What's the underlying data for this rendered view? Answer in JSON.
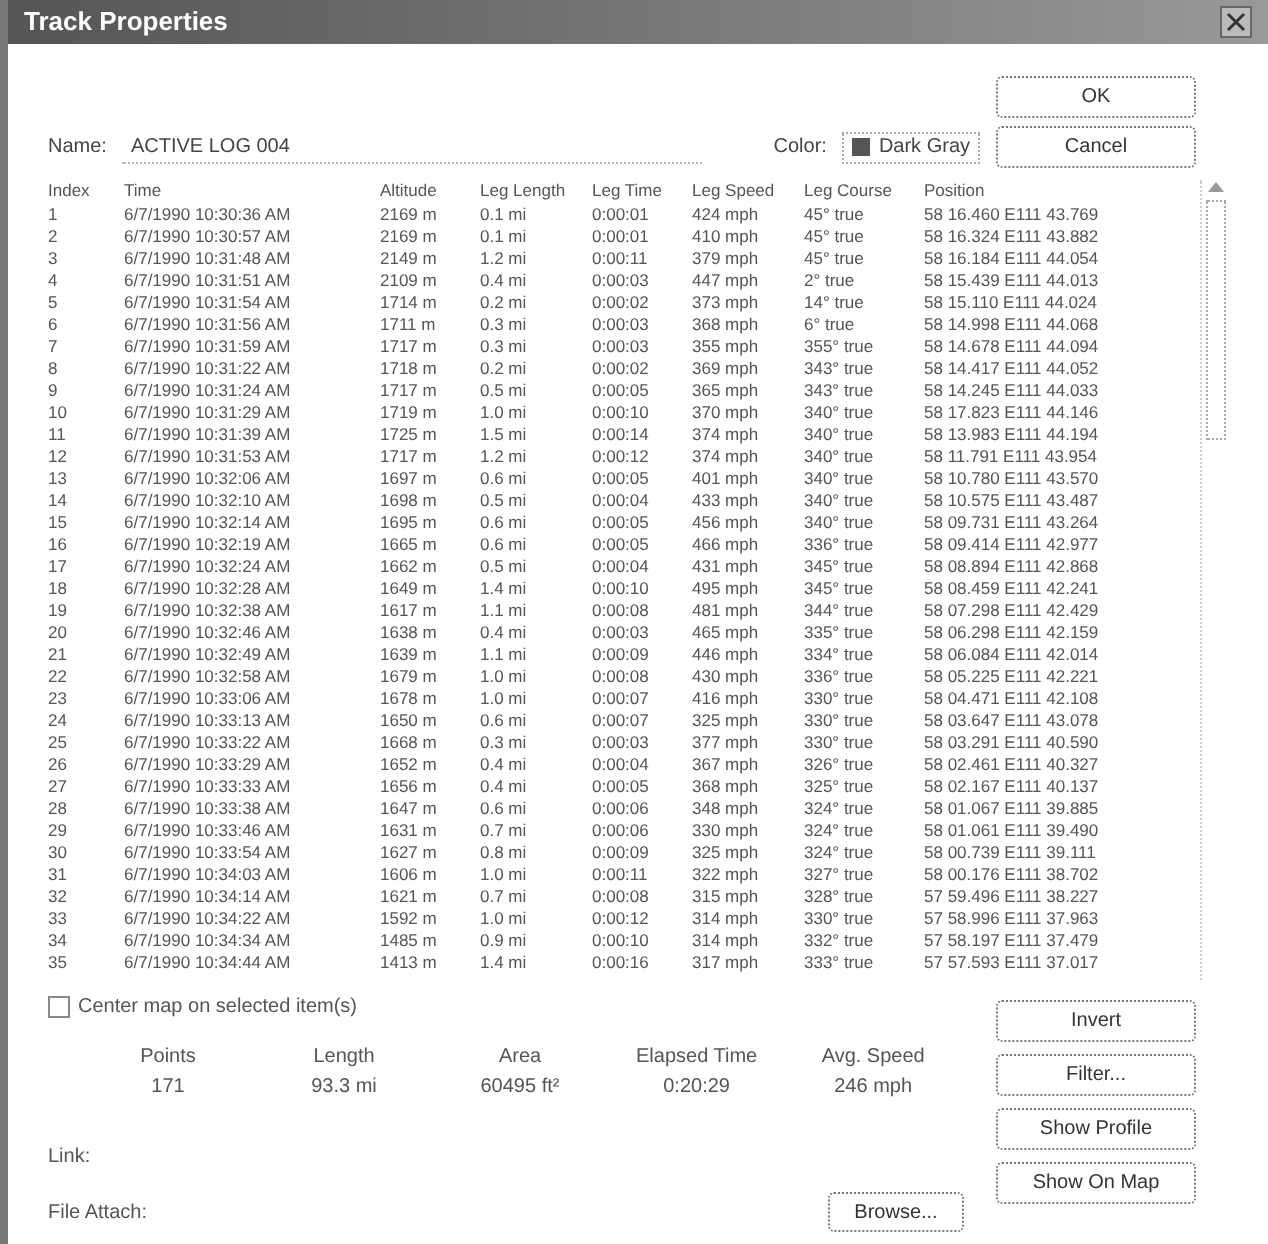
{
  "window": {
    "title": "Track Properties"
  },
  "name_field": {
    "label": "Name:",
    "value": "ACTIVE LOG 004"
  },
  "color_field": {
    "label": "Color:",
    "value": "Dark Gray",
    "color": "#555555"
  },
  "buttons_top": [
    "OK",
    "Cancel"
  ],
  "table": {
    "columns": [
      "Index",
      "Time",
      "Altitude",
      "Leg Length",
      "Leg Time",
      "Leg Speed",
      "Leg Course",
      "Position"
    ],
    "rows": [
      [
        "1",
        "6/7/1990 10:30:36 AM",
        "2169 m",
        "0.1 mi",
        "0:00:01",
        "424 mph",
        "45° true",
        "58 16.460 E111 43.769"
      ],
      [
        "2",
        "6/7/1990 10:30:57 AM",
        "2169 m",
        "0.1 mi",
        "0:00:01",
        "410 mph",
        "45° true",
        "58 16.324 E111 43.882"
      ],
      [
        "3",
        "6/7/1990 10:31:48 AM",
        "2149 m",
        "1.2 mi",
        "0:00:11",
        "379 mph",
        "45° true",
        "58 16.184 E111 44.054"
      ],
      [
        "4",
        "6/7/1990 10:31:51 AM",
        "2109 m",
        "0.4 mi",
        "0:00:03",
        "447 mph",
        "2° true",
        "58 15.439 E111 44.013"
      ],
      [
        "5",
        "6/7/1990 10:31:54 AM",
        "1714 m",
        "0.2 mi",
        "0:00:02",
        "373 mph",
        "14° true",
        "58 15.110 E111 44.024"
      ],
      [
        "6",
        "6/7/1990 10:31:56 AM",
        "1711 m",
        "0.3 mi",
        "0:00:03",
        "368 mph",
        "6° true",
        "58 14.998 E111 44.068"
      ],
      [
        "7",
        "6/7/1990 10:31:59 AM",
        "1717 m",
        "0.3 mi",
        "0:00:03",
        "355 mph",
        "355° true",
        "58 14.678 E111 44.094"
      ],
      [
        "8",
        "6/7/1990 10:31:22 AM",
        "1718 m",
        "0.2 mi",
        "0:00:02",
        "369 mph",
        "343° true",
        "58 14.417 E111 44.052"
      ],
      [
        "9",
        "6/7/1990 10:31:24 AM",
        "1717 m",
        "0.5 mi",
        "0:00:05",
        "365 mph",
        "343° true",
        "58 14.245 E111 44.033"
      ],
      [
        "10",
        "6/7/1990 10:31:29 AM",
        "1719 m",
        "1.0 mi",
        "0:00:10",
        "370 mph",
        "340° true",
        "58 17.823 E111 44.146"
      ],
      [
        "11",
        "6/7/1990 10:31:39 AM",
        "1725 m",
        "1.5 mi",
        "0:00:14",
        "374 mph",
        "340° true",
        "58 13.983 E111 44.194"
      ],
      [
        "12",
        "6/7/1990 10:31:53 AM",
        "1717 m",
        "1.2 mi",
        "0:00:12",
        "374 mph",
        "340° true",
        "58 11.791 E111 43.954"
      ],
      [
        "13",
        "6/7/1990 10:32:06 AM",
        "1697 m",
        "0.6 mi",
        "0:00:05",
        "401 mph",
        "340° true",
        "58 10.780 E111 43.570"
      ],
      [
        "14",
        "6/7/1990 10:32:10 AM",
        "1698 m",
        "0.5 mi",
        "0:00:04",
        "433 mph",
        "340° true",
        "58 10.575 E111 43.487"
      ],
      [
        "15",
        "6/7/1990 10:32:14 AM",
        "1695 m",
        "0.6 mi",
        "0:00:05",
        "456 mph",
        "340° true",
        "58 09.731 E111 43.264"
      ],
      [
        "16",
        "6/7/1990 10:32:19 AM",
        "1665 m",
        "0.6 mi",
        "0:00:05",
        "466 mph",
        "336° true",
        "58 09.414 E111 42.977"
      ],
      [
        "17",
        "6/7/1990 10:32:24 AM",
        "1662 m",
        "0.5 mi",
        "0:00:04",
        "431 mph",
        "345° true",
        "58 08.894 E111 42.868"
      ],
      [
        "18",
        "6/7/1990 10:32:28 AM",
        "1649 m",
        "1.4 mi",
        "0:00:10",
        "495 mph",
        "345° true",
        "58 08.459 E111 42.241"
      ],
      [
        "19",
        "6/7/1990 10:32:38 AM",
        "1617 m",
        "1.1 mi",
        "0:00:08",
        "481 mph",
        "344° true",
        "58 07.298 E111 42.429"
      ],
      [
        "20",
        "6/7/1990 10:32:46 AM",
        "1638 m",
        "0.4 mi",
        "0:00:03",
        "465 mph",
        "335° true",
        "58 06.298 E111 42.159"
      ],
      [
        "21",
        "6/7/1990 10:32:49 AM",
        "1639 m",
        "1.1 mi",
        "0:00:09",
        "446 mph",
        "334° true",
        "58 06.084 E111 42.014"
      ],
      [
        "22",
        "6/7/1990 10:32:58 AM",
        "1679 m",
        "1.0 mi",
        "0:00:08",
        "430 mph",
        "336° true",
        "58 05.225 E111 42.221"
      ],
      [
        "23",
        "6/7/1990 10:33:06 AM",
        "1678 m",
        "1.0 mi",
        "0:00:07",
        "416 mph",
        "330° true",
        "58 04.471 E111 42.108"
      ],
      [
        "24",
        "6/7/1990 10:33:13 AM",
        "1650 m",
        "0.6 mi",
        "0:00:07",
        "325 mph",
        "330° true",
        "58 03.647 E111 43.078"
      ],
      [
        "25",
        "6/7/1990 10:33:22 AM",
        "1668 m",
        "0.3 mi",
        "0:00:03",
        "377 mph",
        "330° true",
        "58 03.291 E111 40.590"
      ],
      [
        "26",
        "6/7/1990 10:33:29 AM",
        "1652 m",
        "0.4 mi",
        "0:00:04",
        "367 mph",
        "326° true",
        "58 02.461 E111 40.327"
      ],
      [
        "27",
        "6/7/1990 10:33:33 AM",
        "1656 m",
        "0.4 mi",
        "0:00:05",
        "368 mph",
        "325° true",
        "58 02.167 E111 40.137"
      ],
      [
        "28",
        "6/7/1990 10:33:38 AM",
        "1647 m",
        "0.6 mi",
        "0:00:06",
        "348 mph",
        "324° true",
        "58 01.067 E111 39.885"
      ],
      [
        "29",
        "6/7/1990 10:33:46 AM",
        "1631 m",
        "0.7 mi",
        "0:00:06",
        "330 mph",
        "324° true",
        "58 01.061 E111 39.490"
      ],
      [
        "30",
        "6/7/1990 10:33:54 AM",
        "1627 m",
        "0.8 mi",
        "0:00:09",
        "325 mph",
        "324° true",
        "58 00.739 E111 39.111"
      ],
      [
        "31",
        "6/7/1990 10:34:03 AM",
        "1606 m",
        "1.0 mi",
        "0:00:11",
        "322 mph",
        "327° true",
        "58 00.176 E111 38.702"
      ],
      [
        "32",
        "6/7/1990 10:34:14 AM",
        "1621 m",
        "0.7 mi",
        "0:00:08",
        "315 mph",
        "328° true",
        "57 59.496 E111 38.227"
      ],
      [
        "33",
        "6/7/1990 10:34:22 AM",
        "1592 m",
        "1.0 mi",
        "0:00:12",
        "314 mph",
        "330° true",
        "57 58.996 E111 37.963"
      ],
      [
        "34",
        "6/7/1990 10:34:34 AM",
        "1485 m",
        "0.9 mi",
        "0:00:10",
        "314 mph",
        "332° true",
        "57 58.197 E111 37.479"
      ],
      [
        "35",
        "6/7/1990 10:34:44 AM",
        "1413 m",
        "1.4 mi",
        "0:00:16",
        "317 mph",
        "333° true",
        "57 57.593 E111 37.017"
      ]
    ]
  },
  "center_map": {
    "label": "Center map on selected item(s)",
    "checked": false
  },
  "stats": [
    {
      "label": "Points",
      "value": "171"
    },
    {
      "label": "Length",
      "value": "93.3 mi"
    },
    {
      "label": "Area",
      "value": "60495 ft²"
    },
    {
      "label": "Elapsed Time",
      "value": "0:20:29"
    },
    {
      "label": "Avg. Speed",
      "value": "246 mph"
    }
  ],
  "side_buttons": [
    "Invert",
    "Filter...",
    "Show Profile",
    "Show On Map"
  ],
  "link": {
    "label": "Link:"
  },
  "file_attach": {
    "label": "File Attach:"
  },
  "browse_button": "Browse..."
}
